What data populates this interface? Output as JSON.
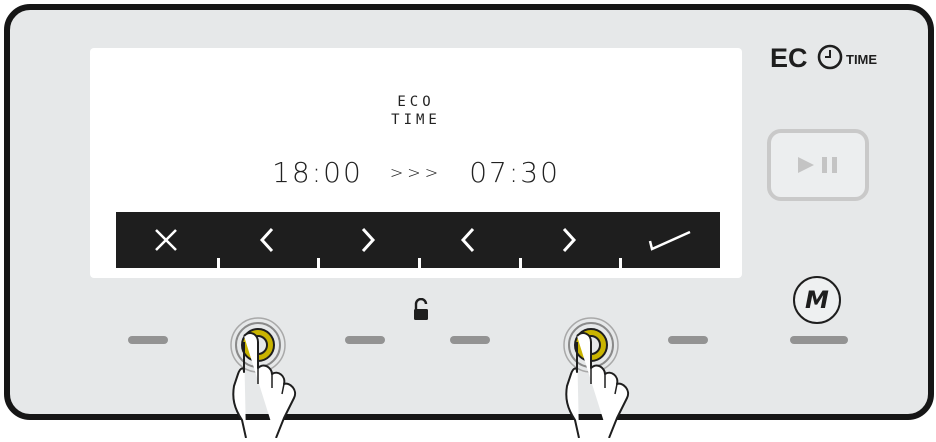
{
  "brand": {
    "eco": "EC",
    "time": "TIME"
  },
  "display": {
    "mode_line1": "ECO",
    "mode_line2": "TIME",
    "start_time": "18:00",
    "arrows": ">>>",
    "end_time": "07:30"
  },
  "softkeys": [
    {
      "label": "cancel",
      "icon": "x-icon"
    },
    {
      "label": "decrease-start",
      "icon": "chevron-left-icon"
    },
    {
      "label": "increase-start",
      "icon": "chevron-right-icon"
    },
    {
      "label": "decrease-end",
      "icon": "chevron-left-icon"
    },
    {
      "label": "increase-end",
      "icon": "chevron-right-icon"
    },
    {
      "label": "confirm",
      "icon": "check-icon"
    }
  ],
  "buttons": {
    "play_pause_icon": "play-pause-icon",
    "menu": "M"
  },
  "status": {
    "lock_icon": "unlock-icon"
  },
  "colors": {
    "frame": "#161616",
    "panel": "#e6e8e9",
    "bar": "#1e1e1e",
    "touch_ring": "#c9b400"
  }
}
